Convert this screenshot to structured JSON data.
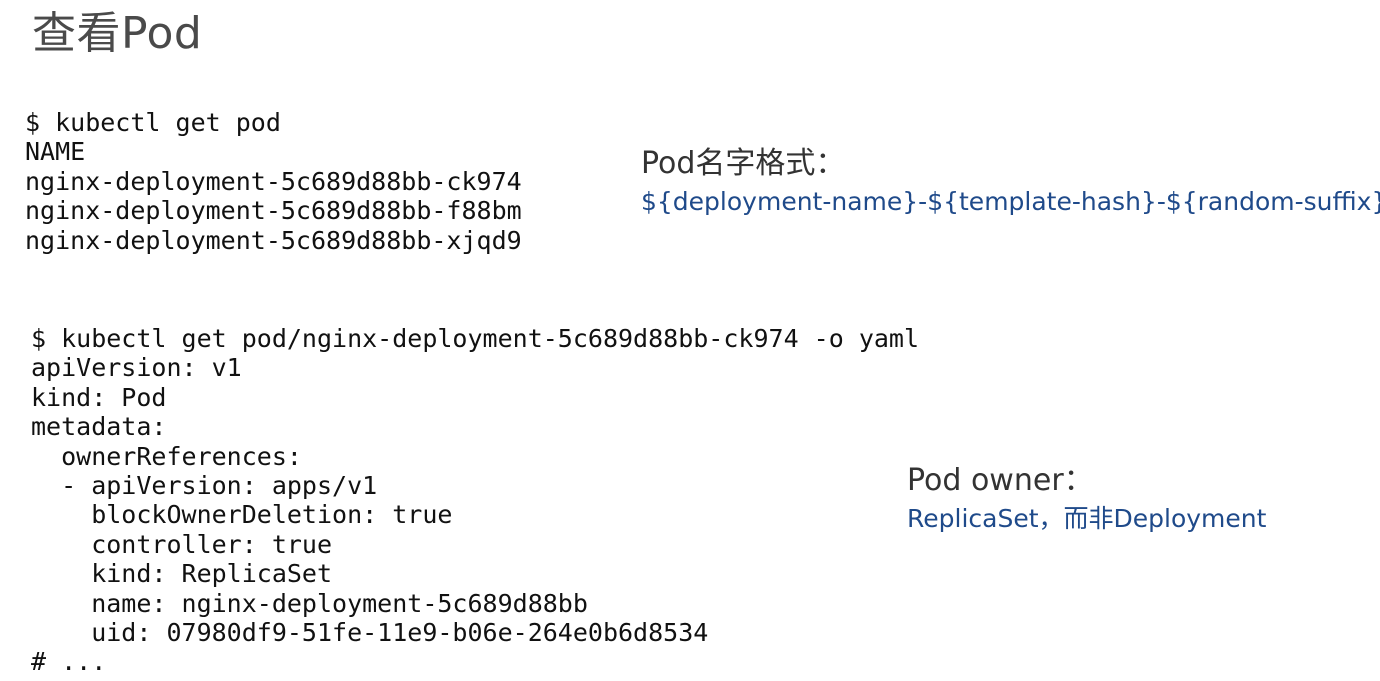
{
  "slide": {
    "title": "查看Pod",
    "accent_color": "#1f4a8a"
  },
  "code_block_1": {
    "lines": [
      "$ kubectl get pod",
      "NAME",
      "nginx-deployment-5c689d88bb-ck974",
      "nginx-deployment-5c689d88bb-f88bm",
      "nginx-deployment-5c689d88bb-xjqd9"
    ]
  },
  "code_block_2": {
    "lines": [
      "$ kubectl get pod/nginx-deployment-5c689d88bb-ck974 -o yaml",
      "apiVersion: v1",
      "kind: Pod",
      "metadata:",
      "  ownerReferences:",
      "  - apiVersion: apps/v1",
      "    blockOwnerDeletion: true",
      "    controller: true",
      "    kind: ReplicaSet",
      "    name: nginx-deployment-5c689d88bb",
      "    uid: 07980df9-51fe-11e9-b06e-264e0b6d8534",
      "# ..."
    ]
  },
  "notes": {
    "pod_name": {
      "heading": "Pod名字格式：",
      "value": "${deployment-name}-${template-hash}-${random-suffix}"
    },
    "pod_owner": {
      "heading": "Pod owner：",
      "value": "ReplicaSet，而非Deployment"
    }
  }
}
